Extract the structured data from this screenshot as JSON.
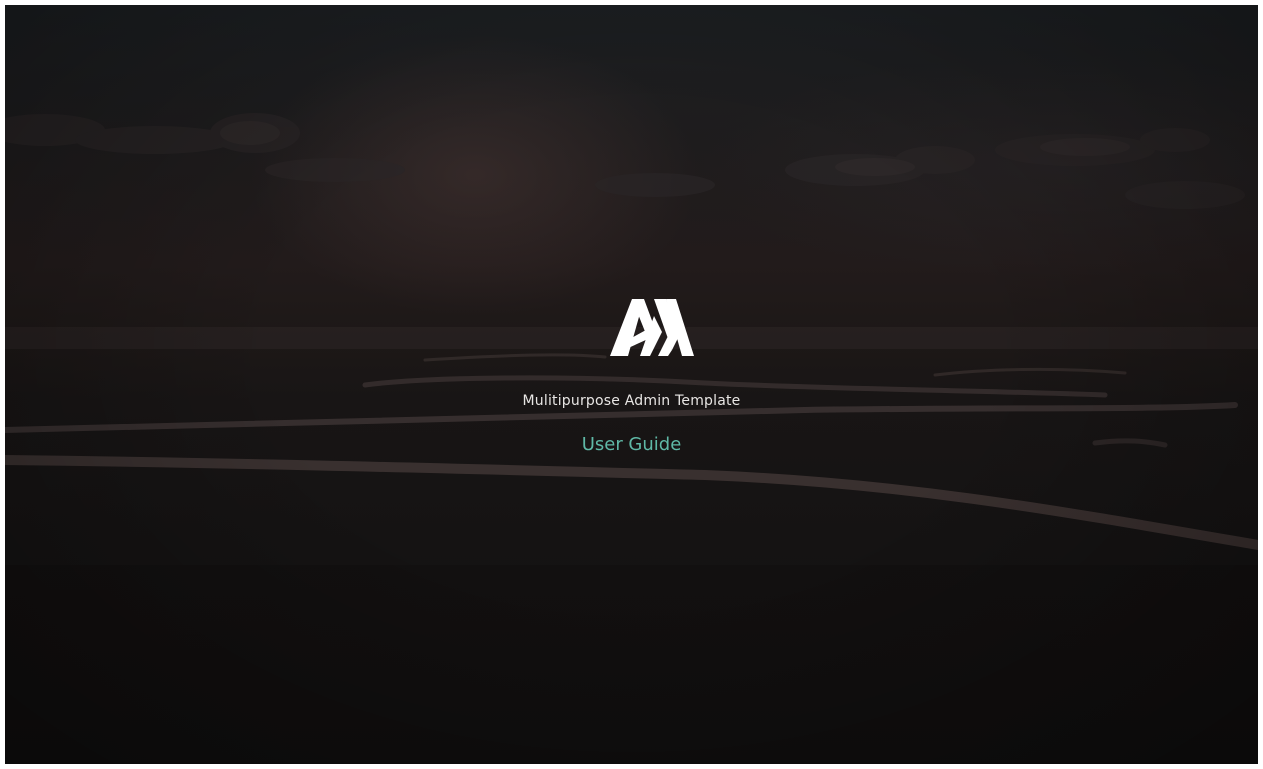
{
  "brand": {
    "logo_icon": "am-logo-icon",
    "logo_text": "AM"
  },
  "hero": {
    "tagline": "Mulitipurpose Admin Template",
    "guide_link_label": "User Guide"
  },
  "colors": {
    "link": "#5fb8a6",
    "text": "#e8e6e4",
    "background": "#141313"
  }
}
